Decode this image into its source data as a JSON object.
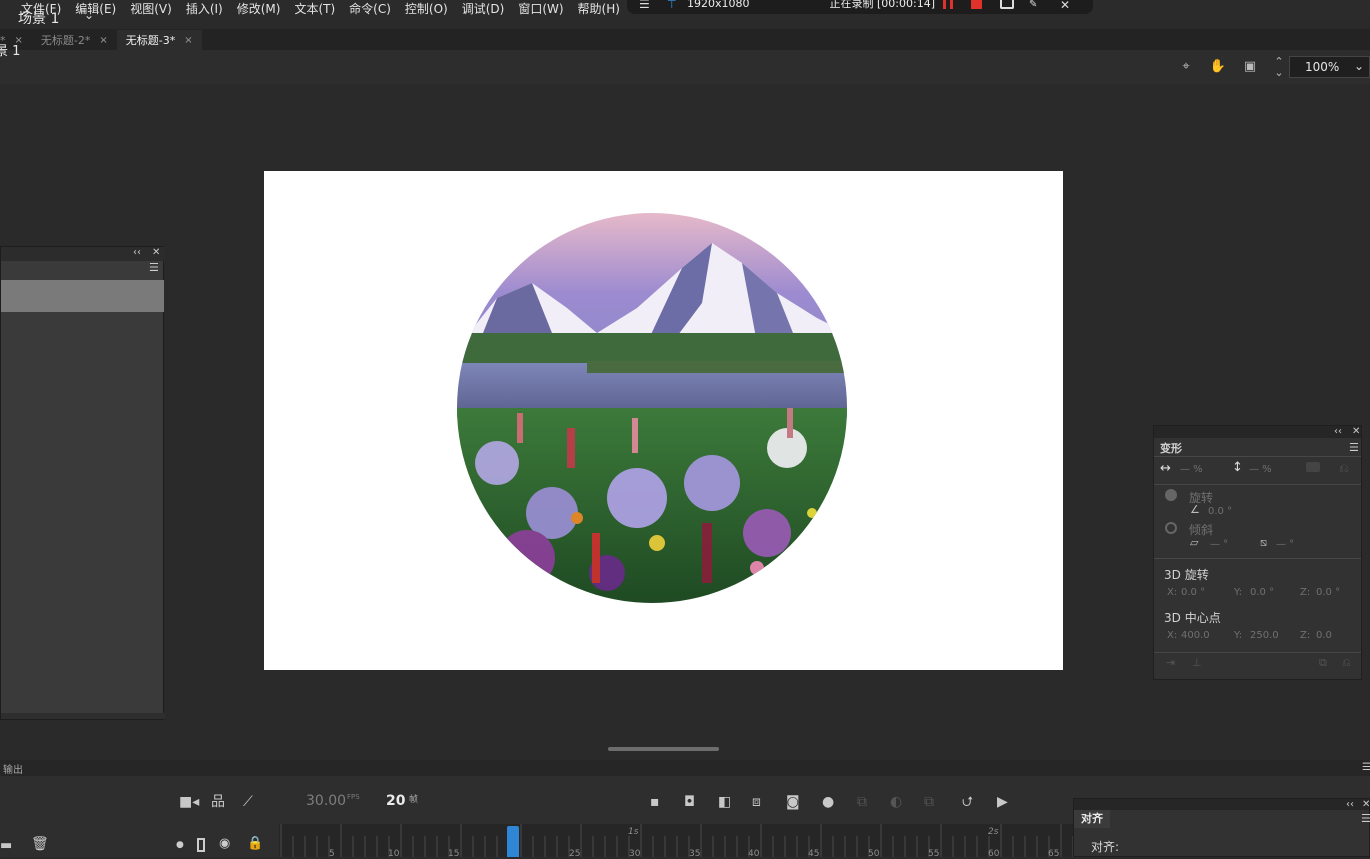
{
  "menubar": {
    "items": [
      "文件(F)",
      "编辑(E)",
      "视图(V)",
      "插入(I)",
      "修改(M)",
      "文本(T)",
      "命令(C)",
      "控制(O)",
      "调试(D)",
      "窗口(W)",
      "帮助(H)"
    ]
  },
  "recorder": {
    "resolution": "1920x1080",
    "status": "正在录制 [00:00:14]"
  },
  "tabs": [
    {
      "label": "*",
      "active": false
    },
    {
      "label": "无标题-2*",
      "active": false
    },
    {
      "label": "无标题-3*",
      "active": true
    }
  ],
  "scene": {
    "label": "场景 1",
    "zoom": "100%"
  },
  "scenes_panel": {
    "row": "景 1"
  },
  "transform": {
    "title": "变形",
    "width_pct": "— %",
    "height_pct": "— %",
    "rotate_label": "旋转",
    "rotate_value": "0.0 °",
    "skew_label": "倾斜",
    "skew_h": "— °",
    "skew_v": "— °",
    "rot3d_label": "3D 旋转",
    "rot3d": {
      "x": "0.0 °",
      "y": "0.0 °",
      "z": "0.0 °"
    },
    "center3d_label": "3D 中心点",
    "center3d": {
      "x": "400.0",
      "y": "250.0",
      "z": "0.0"
    },
    "x_label": "X:",
    "y_label": "Y:",
    "z_label": "Z:"
  },
  "output": {
    "label": "输出"
  },
  "timeline": {
    "fps": "30.00",
    "fps_unit": "FPS",
    "frame": "20",
    "frame_unit": "帧",
    "ruler_numbers": [
      "5",
      "10",
      "15",
      "20",
      "25",
      "30",
      "35",
      "40",
      "45",
      "50",
      "55",
      "60",
      "65"
    ],
    "second_markers": [
      "1s",
      "2s"
    ]
  },
  "align": {
    "tab": "对齐",
    "label": "对齐:"
  }
}
